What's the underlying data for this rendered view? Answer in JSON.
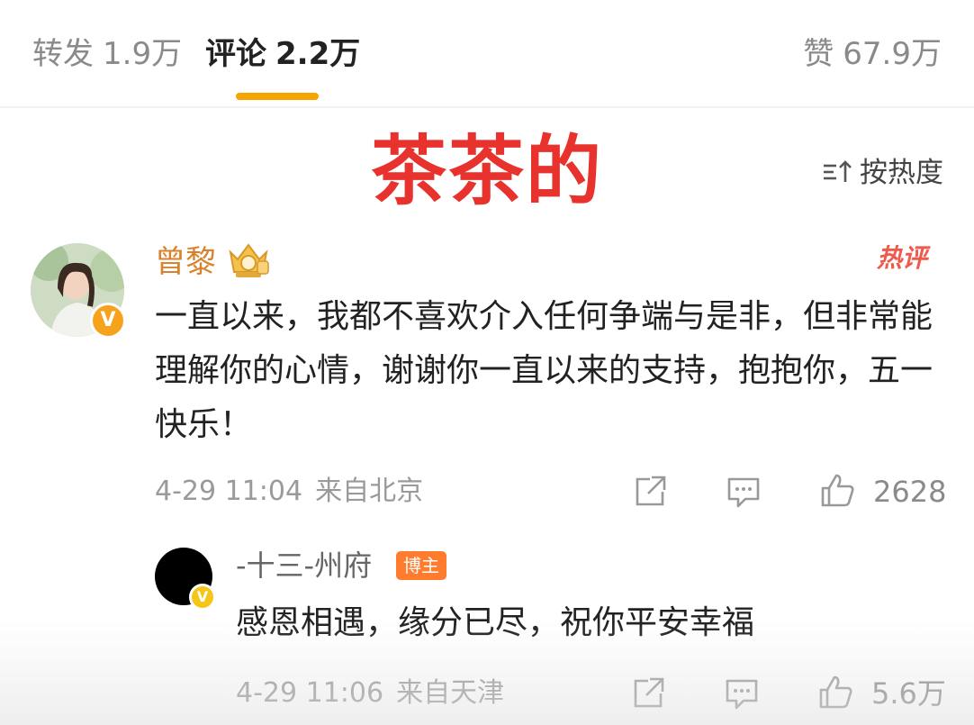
{
  "tabs": {
    "repost": {
      "label": "转发",
      "count": "1.9万"
    },
    "comment": {
      "label": "评论",
      "count": "2.2万"
    },
    "like": {
      "label": "赞",
      "count": "67.9万"
    }
  },
  "overlay_title": "茶茶的",
  "sort": {
    "label": "按热度",
    "icon": "sort-icon"
  },
  "main_comment": {
    "username": "曾黎",
    "hot_badge": "热评",
    "text": "一直以来，我都不喜欢介入任何争端与是非，但非常能理解你的心情，谢谢你一直以来的支持，抱抱你，五一快乐！",
    "time": "4-29 11:04",
    "location": "来自北京",
    "likes": "2628",
    "verified_badge": "V"
  },
  "reply": {
    "username": "-十三-州府",
    "author_tag": "博主",
    "text": "感恩相遇，缘分已尽，祝你平安幸福",
    "time": "4-29 11:06",
    "location": "来自天津",
    "likes": "5.6万",
    "verified_badge": "V"
  },
  "colors": {
    "accent": "#f6a400",
    "overlay_red": "#e8322d",
    "username_orange": "#d9822b",
    "hot_red": "#ef5a4b",
    "author_tag": "#ff7b2e"
  }
}
